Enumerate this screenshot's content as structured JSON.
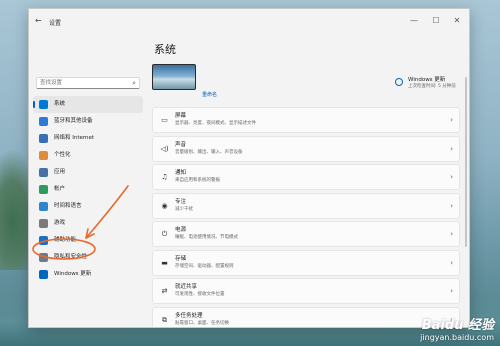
{
  "window": {
    "app_title": "设置",
    "back_glyph": "←",
    "minimize_glyph": "—",
    "maximize_glyph": "☐",
    "close_glyph": "✕"
  },
  "search": {
    "placeholder": "查找设置",
    "icon": "search-icon"
  },
  "sidebar": {
    "items": [
      {
        "label": "系统",
        "icon": "monitor-icon",
        "color": "#0078d4",
        "active": true
      },
      {
        "label": "蓝牙和其他设备",
        "icon": "bluetooth-icon",
        "color": "#2d7bd6"
      },
      {
        "label": "网络和 Internet",
        "icon": "wifi-icon",
        "color": "#3a6fb8"
      },
      {
        "label": "个性化",
        "icon": "brush-icon",
        "color": "#e08c3a"
      },
      {
        "label": "应用",
        "icon": "apps-icon",
        "color": "#4a6fa5"
      },
      {
        "label": "帐户",
        "icon": "person-icon",
        "color": "#2f9a5f"
      },
      {
        "label": "时间和语言",
        "icon": "clock-globe-icon",
        "color": "#2d86c7"
      },
      {
        "label": "游戏",
        "icon": "gamepad-icon",
        "color": "#7a7a7a"
      },
      {
        "label": "辅助功能",
        "icon": "accessibility-icon",
        "color": "#1e6fc2"
      },
      {
        "label": "隐私和安全性",
        "icon": "shield-icon",
        "color": "#6c7a89"
      },
      {
        "label": "Windows 更新",
        "icon": "windows-update-icon",
        "color": "#0067c0"
      }
    ]
  },
  "main": {
    "title": "系统",
    "rename_link": "重命名",
    "update": {
      "title": "Windows 更新",
      "subtitle": "上次检查时间: 5 分钟前"
    },
    "cards": [
      {
        "title": "屏幕",
        "subtitle": "显示器、亮度、夜间模式、显示描述文件",
        "icon": "display-icon",
        "glyph": "▭"
      },
      {
        "title": "声音",
        "subtitle": "音量级别、输出、输入、声音设备",
        "icon": "speaker-icon",
        "glyph": "◁)"
      },
      {
        "title": "通知",
        "subtitle": "来自应用和系统的警报",
        "icon": "bell-icon",
        "glyph": "♫"
      },
      {
        "title": "专注",
        "subtitle": "减少干扰",
        "icon": "focus-icon",
        "glyph": "◉"
      },
      {
        "title": "电源",
        "subtitle": "睡眠、电池使用情况、节电模式",
        "icon": "power-icon",
        "glyph": "⏻"
      },
      {
        "title": "存储",
        "subtitle": "存储空间、驱动器、配置规则",
        "icon": "storage-icon",
        "glyph": "▬"
      },
      {
        "title": "就近共享",
        "subtitle": "可发现性、接收文件位置",
        "icon": "nearby-share-icon",
        "glyph": "⇄"
      },
      {
        "title": "多任务处理",
        "subtitle": "贴靠窗口、桌面、任务切换",
        "icon": "multitask-icon",
        "glyph": "⧉"
      }
    ],
    "chevron": "›"
  },
  "annotation": {
    "color": "#e8692c"
  },
  "watermark": {
    "logo": "Baidu 经验",
    "url": "jingyan.baidu.com"
  }
}
